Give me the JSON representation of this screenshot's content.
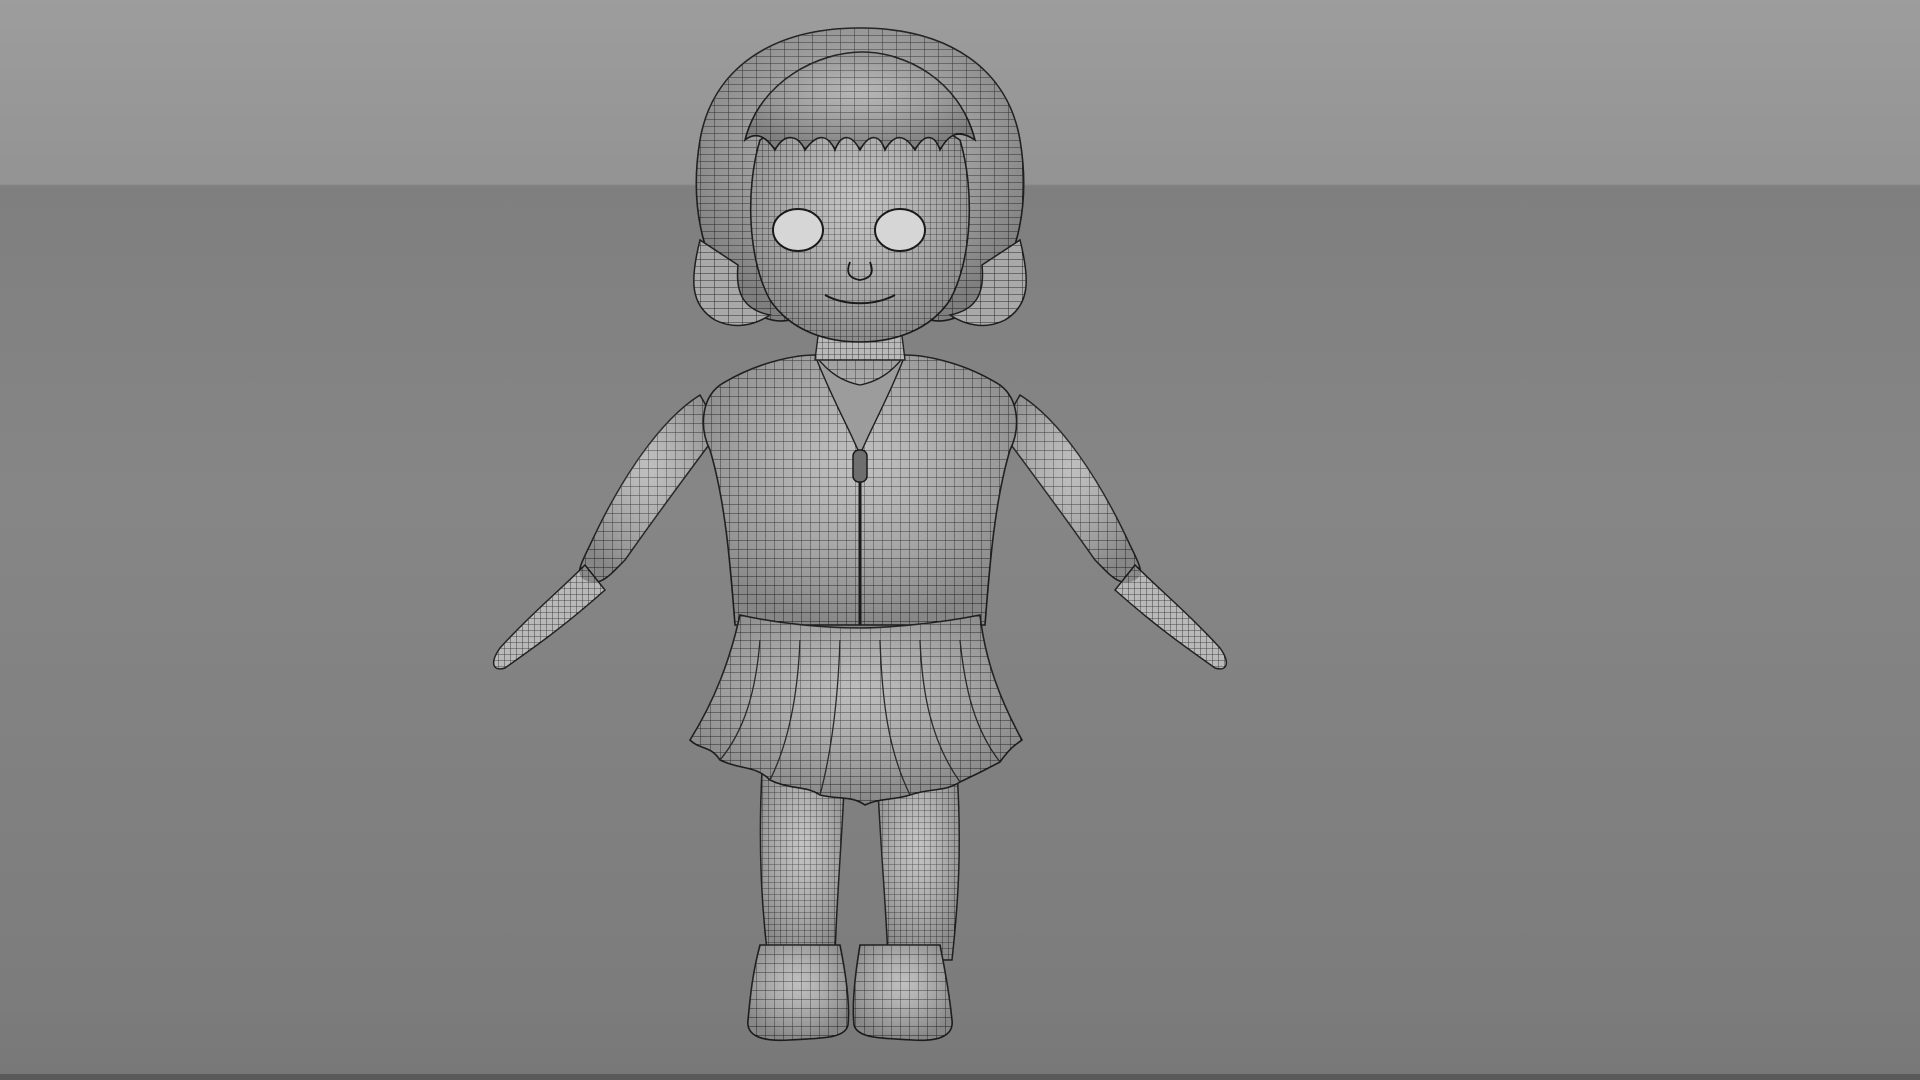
{
  "viewport": {
    "view": "front-orthographic",
    "display_mode": "wireframe-on-shaded",
    "background_colors": {
      "top": "#9d9d9d",
      "bottom": "#7a7a7a"
    }
  },
  "scene": {
    "model_subject": "stylized-girl-character",
    "pose": "A-pose"
  }
}
